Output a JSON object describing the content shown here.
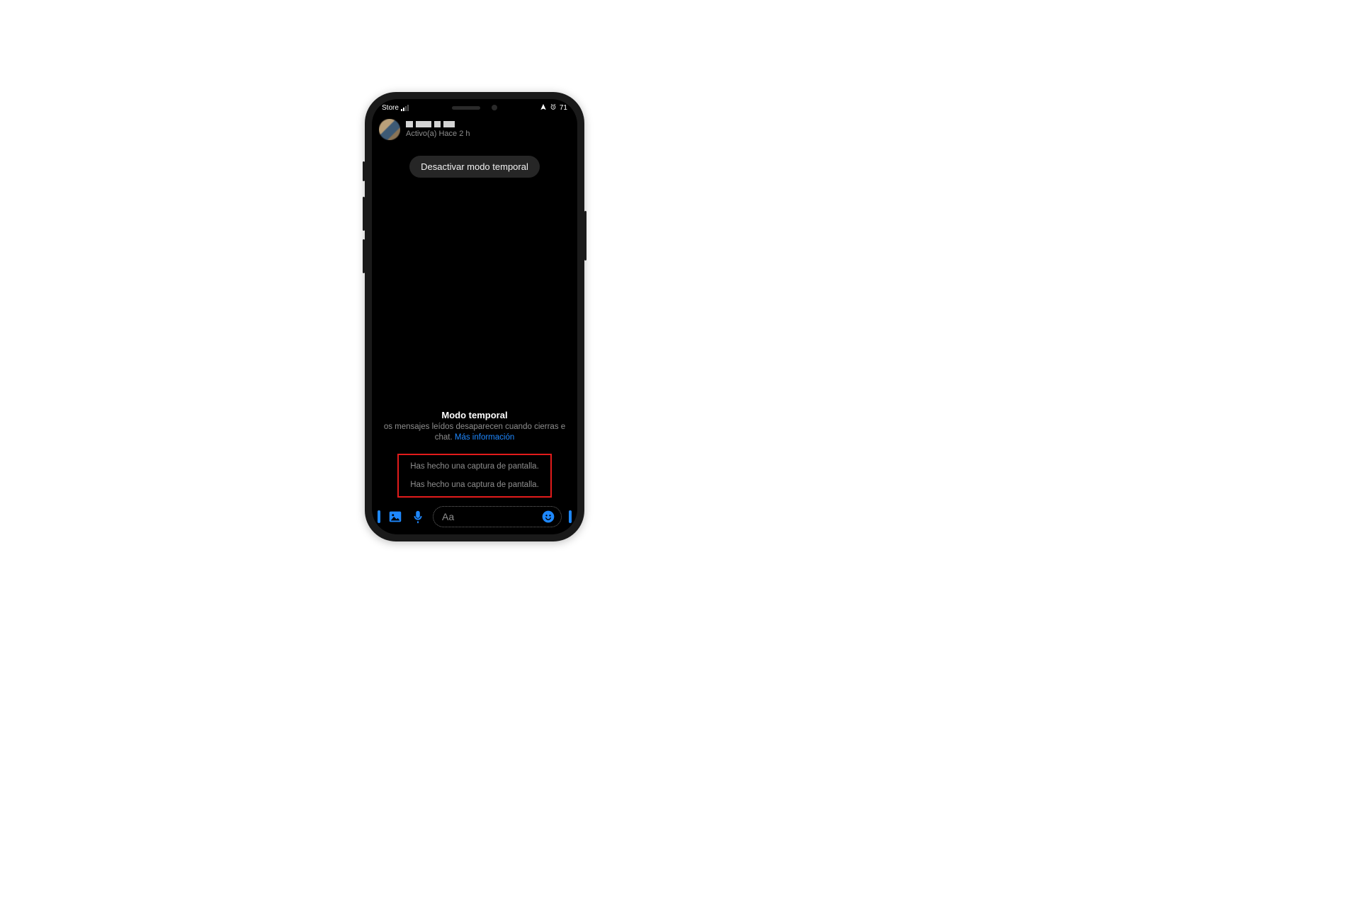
{
  "statusBar": {
    "leftLabel": "Store",
    "battery": "71"
  },
  "header": {
    "status": "Activo(a) Hace 2 h"
  },
  "pill": {
    "label": "Desactivar modo temporal"
  },
  "info": {
    "title": "Modo temporal",
    "descPrefix": "os mensajes leídos desaparecen cuando cierras e",
    "descSuffix": "chat. ",
    "link": "Más información"
  },
  "systemMessages": [
    "Has hecho una captura de pantalla.",
    "Has hecho una captura de pantalla."
  ],
  "input": {
    "placeholder": "Aa"
  }
}
